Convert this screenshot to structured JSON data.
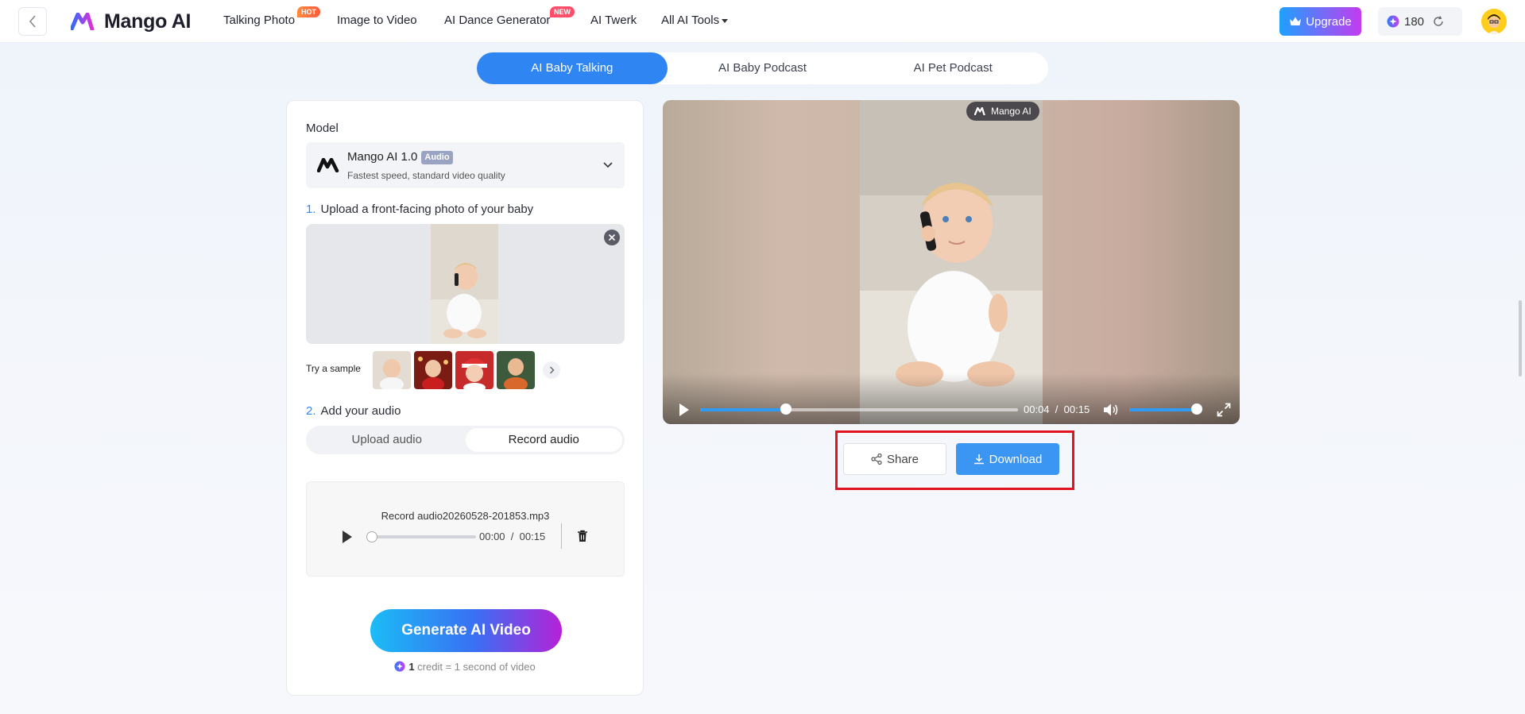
{
  "nav": {
    "logo_text": "Mango AI",
    "items": [
      "Talking Photo",
      "Image to Video",
      "AI Dance Generator",
      "AI Twerk",
      "All AI Tools"
    ],
    "hot_badge": "HOT",
    "new_badge": "NEW",
    "upgrade_label": "Upgrade",
    "credits": "180"
  },
  "mode_tabs": [
    "AI Baby Talking",
    "AI Baby Podcast",
    "AI Pet Podcast"
  ],
  "left": {
    "model_label": "Model",
    "model_name": "Mango AI 1.0",
    "model_tag": "Audio",
    "model_desc": "Fastest speed, standard video quality",
    "step1_num": "1.",
    "step1_label": "Upload a front-facing photo of your baby",
    "sample_label": "Try a sample",
    "step2_num": "2.",
    "step2_label": "Add your audio",
    "audio_tabs": [
      "Upload audio",
      "Record audio"
    ],
    "recording": {
      "filename": "Record audio20260528-201853.mp3",
      "current": "00:00",
      "separator": "/",
      "duration": "00:15",
      "progress": 0
    },
    "generate_label": "Generate AI Video",
    "credit_count": "1",
    "credit_text": "credit = 1 second of video"
  },
  "video": {
    "watermark": "Mango AI",
    "current": "00:04",
    "separator": "/",
    "duration": "00:15",
    "progress": 0.27,
    "volume": 1.0
  },
  "actions": {
    "share_label": "Share",
    "download_label": "Download"
  },
  "colors": {
    "accent": "#2f86f2",
    "highlight": "#e0141e"
  }
}
